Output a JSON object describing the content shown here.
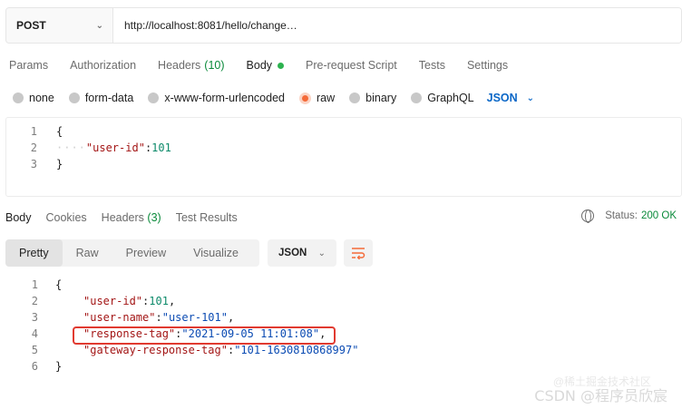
{
  "request": {
    "method": "POST",
    "url": "http://localhost:8081/hello/change…"
  },
  "request_tabs": [
    {
      "label": "Params"
    },
    {
      "label": "Authorization"
    },
    {
      "label": "Headers",
      "count": "(10)"
    },
    {
      "label": "Body",
      "active": true
    },
    {
      "label": "Pre-request Script"
    },
    {
      "label": "Tests"
    },
    {
      "label": "Settings"
    }
  ],
  "body_types": [
    {
      "label": "none"
    },
    {
      "label": "form-data"
    },
    {
      "label": "x-www-form-urlencoded"
    },
    {
      "label": "raw",
      "selected": true
    },
    {
      "label": "binary"
    },
    {
      "label": "GraphQL"
    }
  ],
  "body_language": "JSON",
  "request_body": {
    "line_numbers": [
      "1",
      "2",
      "3"
    ],
    "open": "{",
    "key": "\"user-id\"",
    "colon": ": ",
    "value": "101",
    "close": "}"
  },
  "response_tabs": [
    {
      "label": "Body",
      "active": true
    },
    {
      "label": "Cookies"
    },
    {
      "label": "Headers",
      "count": "(3)"
    },
    {
      "label": "Test Results"
    }
  ],
  "status": {
    "label": "Status:",
    "code": "200 OK"
  },
  "view_modes": [
    "Pretty",
    "Raw",
    "Preview",
    "Visualize"
  ],
  "response_format": "JSON",
  "response_body": {
    "line_numbers": [
      "1",
      "2",
      "3",
      "4",
      "5",
      "6"
    ],
    "open": "{",
    "close": "}",
    "k1": "\"user-id\"",
    "v1": "101",
    "k2": "\"user-name\"",
    "v2": "\"user-101\"",
    "k3": "\"response-tag\"",
    "v3": "\"2021-09-05 11:01:08\"",
    "k4": "\"gateway-response-tag\"",
    "v4": "\"101-1630810868997\""
  },
  "watermark": "CSDN @程序员欣宸",
  "watermark_sub": "@稀土掘金技术社区",
  "colors": {
    "accent": "#f46a38",
    "link_blue": "#0b67c7",
    "success_green": "#0a8a3a",
    "highlight_red": "#e13a30"
  }
}
